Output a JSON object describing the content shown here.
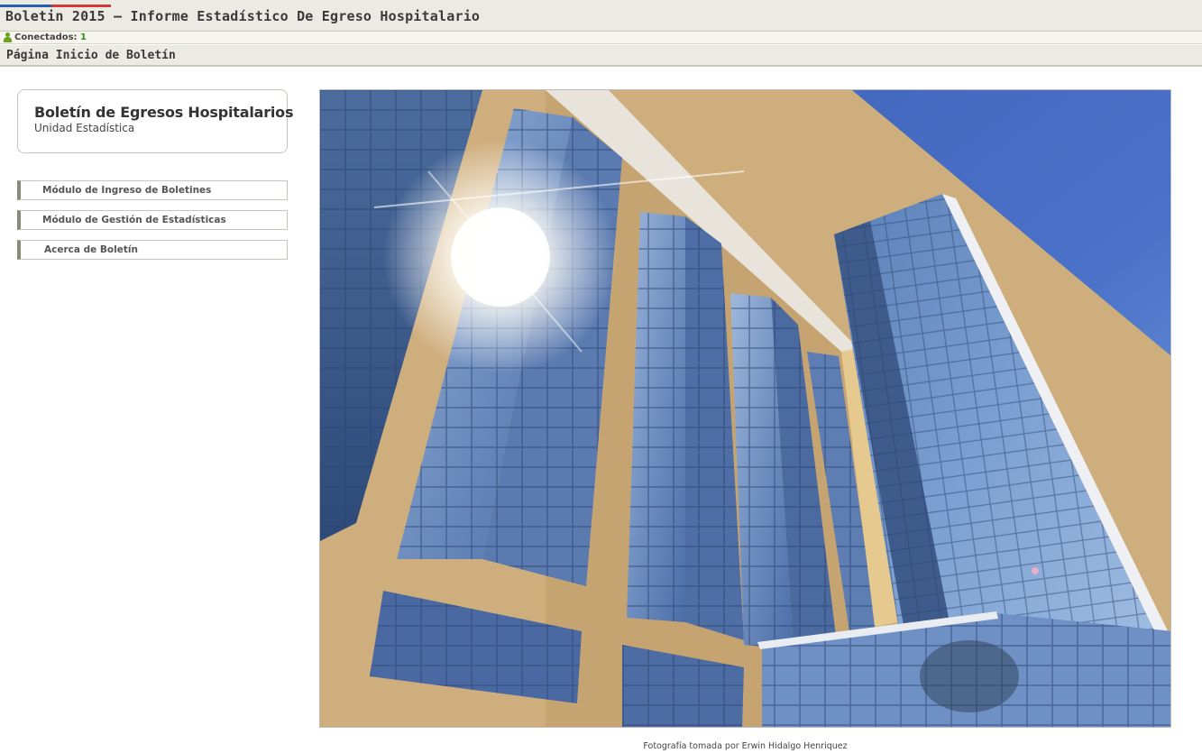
{
  "header": {
    "app_title": "Boletin 2015 — Informe Estadístico De Egreso Hospitalario",
    "flag_colors": [
      "#2a5ea8",
      "#d43838"
    ]
  },
  "status": {
    "label": "Conectados:",
    "count": "1",
    "icon": "user-icon"
  },
  "page": {
    "title": "Página Inicio de Boletín"
  },
  "info": {
    "title": "Boletín de Egresos Hospitalarios",
    "subtitle": "Unidad Estadística"
  },
  "menu": {
    "items": [
      {
        "label": "Módulo de Ingreso de Boletines"
      },
      {
        "label": "Módulo de Gestión de Estadísticas"
      },
      {
        "label": "Acerca de Boletín"
      }
    ]
  },
  "photo": {
    "caption": "Fotografía tomada por Erwin Hidalgo Henriquez"
  }
}
